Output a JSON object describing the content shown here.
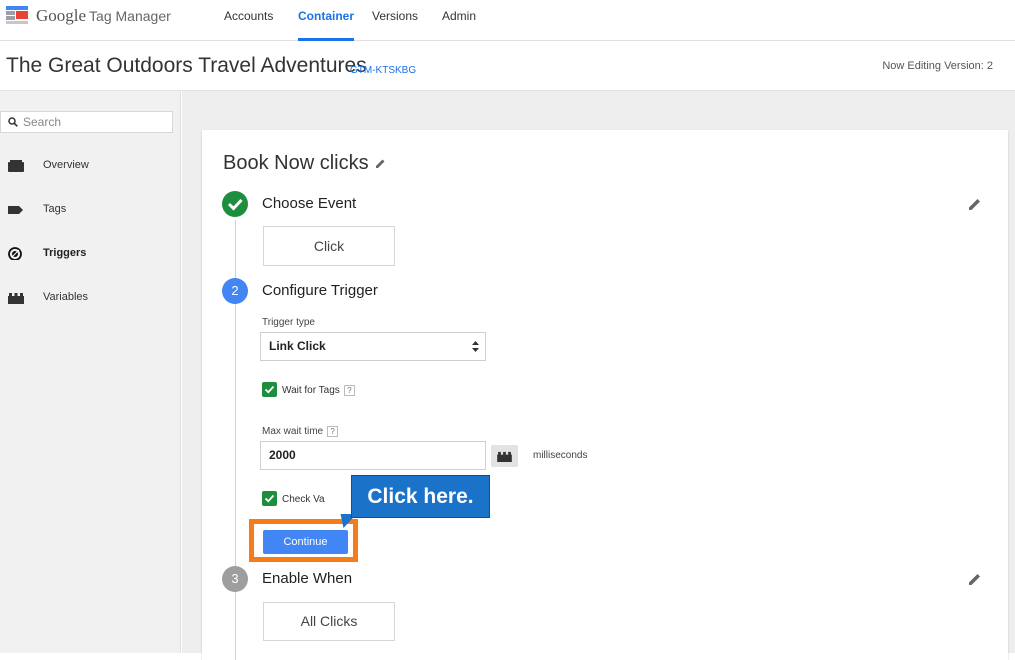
{
  "app": {
    "brand": "Google",
    "product": "Tag Manager",
    "logo_icon": "gtm-logo-icon"
  },
  "topnav": {
    "items": [
      {
        "label": "Accounts"
      },
      {
        "label": "Container",
        "active": true
      },
      {
        "label": "Versions"
      },
      {
        "label": "Admin"
      }
    ]
  },
  "header": {
    "container_name": "The Great Outdoors Travel Adventures",
    "container_id": "GTM-KTSKBG",
    "version_text": "Now Editing Version: 2"
  },
  "sidebar": {
    "search_placeholder": "Search",
    "items": [
      {
        "label": "Overview",
        "icon": "overview-icon"
      },
      {
        "label": "Tags",
        "icon": "tag-icon"
      },
      {
        "label": "Triggers",
        "icon": "trigger-icon",
        "active": true
      },
      {
        "label": "Variables",
        "icon": "variables-icon"
      }
    ]
  },
  "trigger": {
    "name": "Book Now clicks",
    "steps": [
      {
        "number": "",
        "title": "Choose Event",
        "value": "Click",
        "status": "done"
      },
      {
        "number": "2",
        "title": "Configure Trigger",
        "status": "active"
      },
      {
        "number": "3",
        "title": "Enable When",
        "value": "All Clicks",
        "status": "pending"
      }
    ],
    "configure": {
      "trigger_type_label": "Trigger type",
      "trigger_type_value": "Link Click",
      "wait_for_tags_label": "Wait for Tags",
      "wait_for_tags_checked": true,
      "max_wait_label": "Max wait time",
      "max_wait_value": "2000",
      "unit_label": "milliseconds",
      "check_validation_label": "Check Va",
      "check_validation_checked": true,
      "help_glyph": "?",
      "continue_label": "Continue"
    }
  },
  "callout": {
    "text": "Click here."
  },
  "colors": {
    "accent": "#4285f4",
    "done_green": "#1e8e3e",
    "pending_gray": "#9e9e9e",
    "highlight_orange": "#f57c17",
    "callout_blue": "#1a73c8"
  }
}
